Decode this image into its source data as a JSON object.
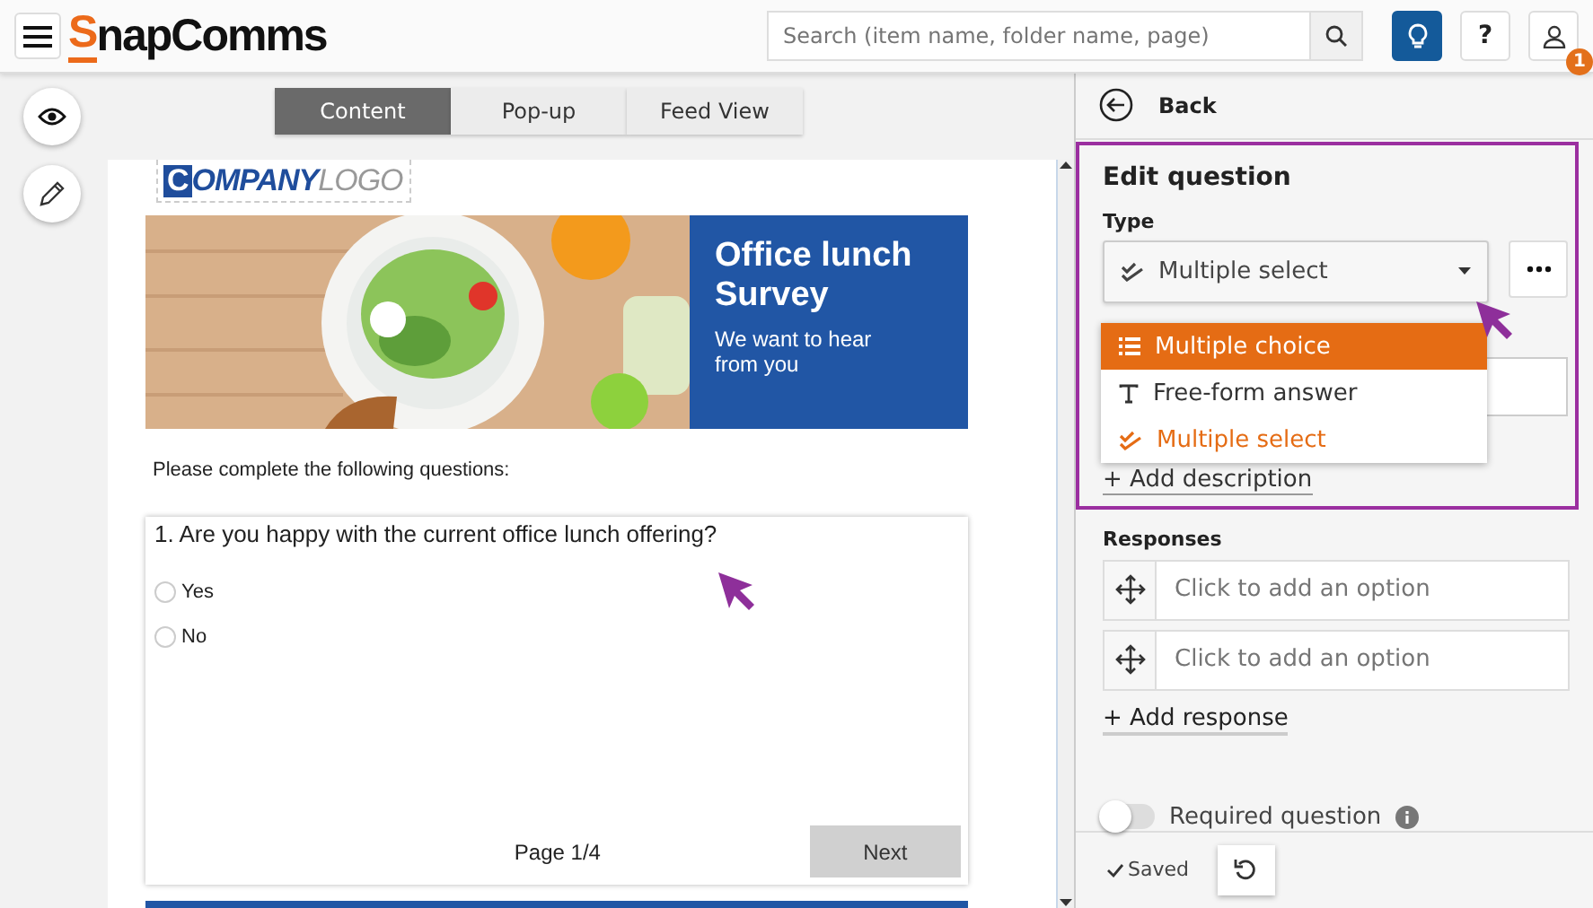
{
  "header": {
    "logo": {
      "initial": "S",
      "rest": "napComms"
    },
    "search": {
      "placeholder": "Search (item name, folder name, page)"
    },
    "help_label": "?",
    "notification_count": "1"
  },
  "view_tabs": [
    {
      "label": "Content",
      "selected": true
    },
    {
      "label": "Pop-up",
      "selected": false
    },
    {
      "label": "Feed View",
      "selected": false
    }
  ],
  "document": {
    "company_logo": {
      "initial": "C",
      "bold": "OMPANY",
      "light": "LOGO"
    },
    "banner": {
      "title": "Office lunch Survey",
      "subtitle": "We want to hear from you"
    },
    "intro": "Please complete the following questions:",
    "question": {
      "text": "1. Are you happy with the current office lunch offering?",
      "options": [
        {
          "label": "Yes",
          "selected": false
        },
        {
          "label": "No",
          "selected": false
        }
      ],
      "page": "Page 1/4",
      "next": "Next"
    }
  },
  "panel": {
    "back": "Back",
    "title": "Edit question",
    "type_label": "Type",
    "type_value": "Multiple select",
    "type_menu": [
      {
        "label": "Multiple choice",
        "kind": "list",
        "hovered": true,
        "selected": false
      },
      {
        "label": "Free-form answer",
        "kind": "text",
        "hovered": false,
        "selected": false
      },
      {
        "label": "Multiple select",
        "kind": "checks",
        "hovered": false,
        "selected": true
      }
    ],
    "add_description": "+ Add description",
    "responses_label": "Responses",
    "responses": [
      {
        "placeholder": "Click to add an option"
      },
      {
        "placeholder": "Click to add an option"
      }
    ],
    "add_response": "+ Add response",
    "required": {
      "label": "Required question",
      "on": false
    },
    "saved": "Saved"
  }
}
